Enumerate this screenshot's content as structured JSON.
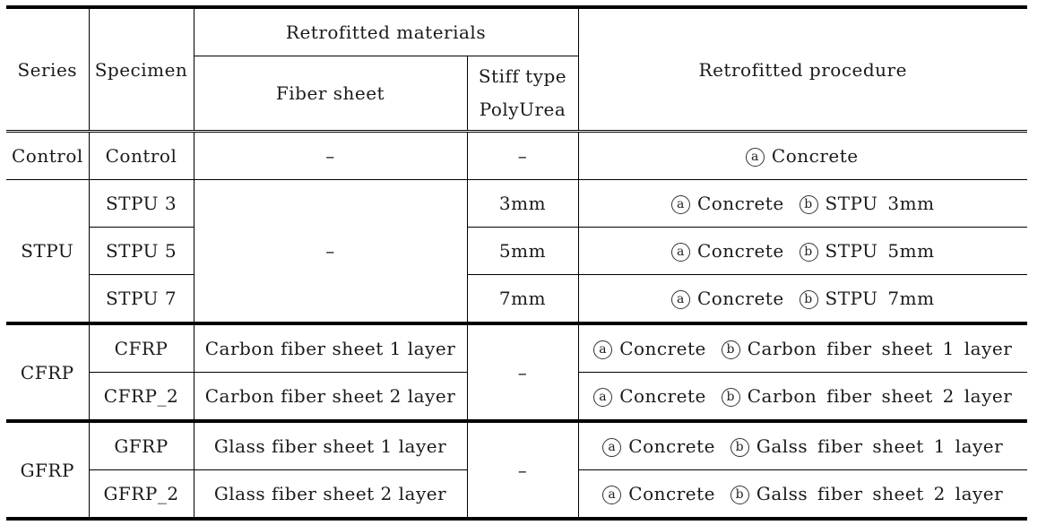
{
  "table": {
    "headers": {
      "series": "Series",
      "specimen": "Specimen",
      "retrofitted_materials": "Retrofitted materials",
      "fiber_sheet": "Fiber sheet",
      "stiff_type_line1": "Stiff type",
      "stiff_type_line2": "PolyUrea",
      "retrofitted_procedure": "Retrofitted procedure"
    },
    "procedure_markers": {
      "a": "a",
      "b": "b"
    },
    "groups": [
      {
        "series": "Control",
        "rows": [
          {
            "specimen": "Control",
            "fiber_sheet": "–",
            "polyurea": "–",
            "step_a": "Concrete",
            "step_b": null
          }
        ]
      },
      {
        "series": "STPU",
        "shared_fiber_sheet": "–",
        "rows": [
          {
            "specimen": "STPU 3",
            "polyurea": "3mm",
            "step_a": "Concrete",
            "step_b": "STPU 3mm"
          },
          {
            "specimen": "STPU 5",
            "polyurea": "5mm",
            "step_a": "Concrete",
            "step_b": "STPU 5mm"
          },
          {
            "specimen": "STPU 7",
            "polyurea": "7mm",
            "step_a": "Concrete",
            "step_b": "STPU 7mm"
          }
        ]
      },
      {
        "series": "CFRP",
        "shared_polyurea": "–",
        "rows": [
          {
            "specimen": "CFRP",
            "fiber_sheet": "Carbon fiber sheet 1 layer",
            "step_a": "Concrete",
            "step_b": "Carbon fiber sheet 1 layer"
          },
          {
            "specimen": "CFRP_2",
            "fiber_sheet": "Carbon fiber sheet 2 layer",
            "step_a": "Concrete",
            "step_b": "Carbon fiber sheet 2 layer"
          }
        ]
      },
      {
        "series": "GFRP",
        "shared_polyurea": "–",
        "rows": [
          {
            "specimen": "GFRP",
            "fiber_sheet": "Glass fiber sheet 1 layer",
            "step_a": "Concrete",
            "step_b": "Galss fiber sheet 1 layer"
          },
          {
            "specimen": "GFRP_2",
            "fiber_sheet": "Glass fiber sheet 2 layer",
            "step_a": "Concrete",
            "step_b": "Galss fiber sheet 2 layer"
          }
        ]
      }
    ]
  }
}
